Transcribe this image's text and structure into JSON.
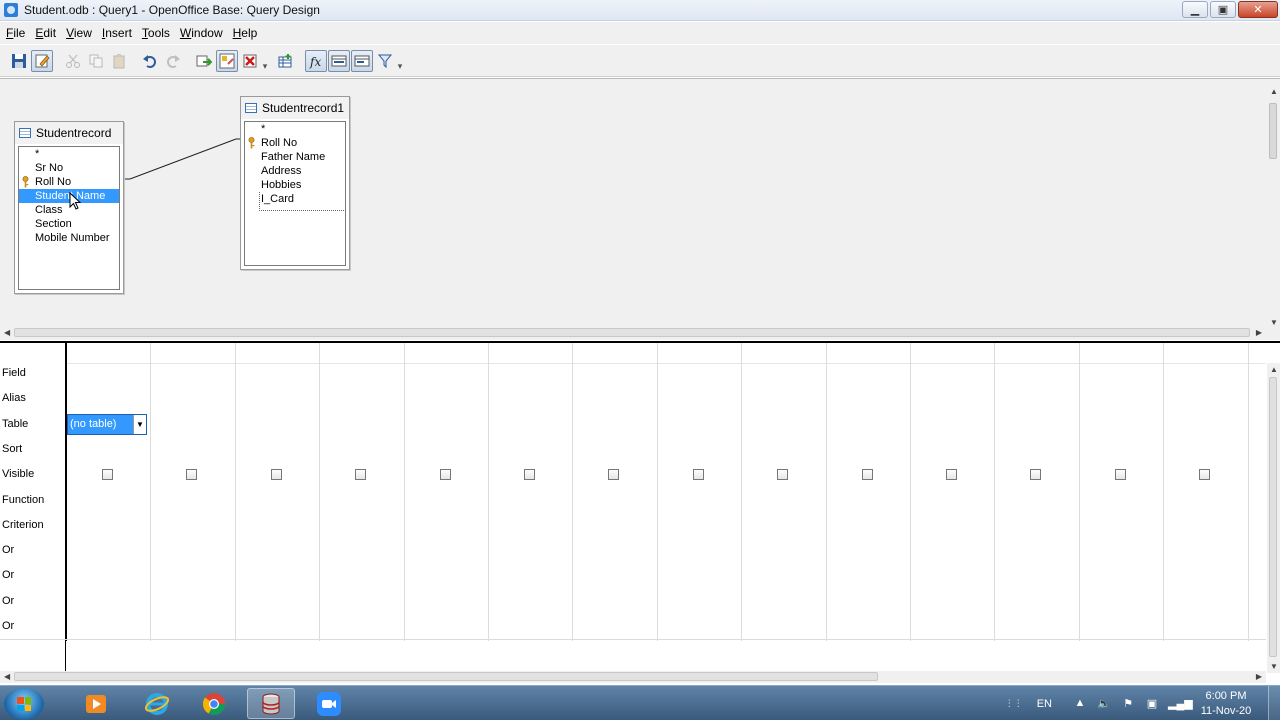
{
  "window": {
    "title": "Student.odb : Query1 - OpenOffice Base: Query Design",
    "minimize": "▁",
    "maximize": "▣",
    "close": "✕"
  },
  "menu": [
    {
      "label": "File",
      "u": "F",
      "rest": "ile"
    },
    {
      "label": "Edit",
      "u": "E",
      "rest": "dit"
    },
    {
      "label": "View",
      "u": "V",
      "rest": "iew"
    },
    {
      "label": "Insert",
      "u": "I",
      "rest": "nsert"
    },
    {
      "label": "Tools",
      "u": "T",
      "rest": "ools"
    },
    {
      "label": "Window",
      "u": "W",
      "rest": "indow"
    },
    {
      "label": "Help",
      "u": "H",
      "rest": "elp"
    }
  ],
  "tables": {
    "studentrecord": {
      "title": "Studentrecord",
      "fields": [
        "*",
        "Sr No",
        "Roll No",
        "Student Name",
        "Class",
        "Section",
        "Mobile Number"
      ],
      "key_field_index": 2,
      "selected_index": 3
    },
    "studentrecord1": {
      "title": "Studentrecord1",
      "fields": [
        "*",
        "Roll No",
        "Father Name",
        "Address",
        "Hobbies",
        "I_Card"
      ],
      "key_field_index": 1
    }
  },
  "grid": {
    "row_labels": [
      "Field",
      "Alias",
      "Table",
      "Sort",
      "Visible",
      "Function",
      "Criterion",
      "Or",
      "Or",
      "Or",
      "Or"
    ],
    "table_combo_value": "(no table)",
    "column_count": 14
  },
  "taskbar": {
    "language": "EN",
    "time": "6:00 PM",
    "date": "11-Nov-20"
  },
  "colors": {
    "selection": "#3399ff",
    "taskbar": "#3a5a7c"
  }
}
